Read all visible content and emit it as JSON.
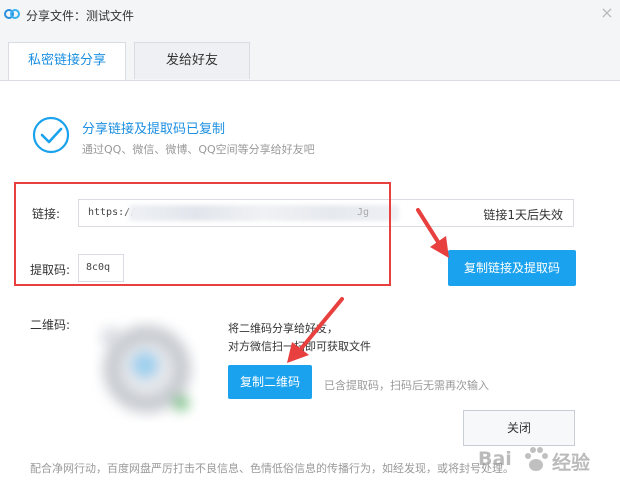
{
  "window": {
    "title": "分享文件：测试文件",
    "close_symbol": "×"
  },
  "tabs": [
    {
      "label": "私密链接分享",
      "active": true
    },
    {
      "label": "发给好友",
      "active": false
    }
  ],
  "status": {
    "title": "分享链接及提取码已复制",
    "subtitle": "通过QQ、微信、微博、QQ空间等分享给好友吧"
  },
  "link": {
    "label": "链接:",
    "url_prefix": "https://",
    "url_suffix": "Jg",
    "expire_text": "链接1天后失效"
  },
  "code": {
    "label": "提取码:",
    "value": "8c0q"
  },
  "buttons": {
    "copy_link": "复制链接及提取码",
    "copy_qr": "复制二维码",
    "close": "关闭"
  },
  "qr": {
    "label": "二维码:",
    "line1": "将二维码分享给好友，",
    "line2": "对方微信扫一扫即可获取文件",
    "note": "已含提取码，扫码后无需再次输入"
  },
  "footer": "配合净网行动，百度网盘严厉打击不良信息、色情低俗信息的传播行为，如经发现，或将封号处理。",
  "watermark": {
    "brand": "Bai",
    "brand2": "经验"
  },
  "colors": {
    "accent": "#1ba2ee",
    "highlight": "#e8403f",
    "link_text": "#1c8fe1"
  }
}
